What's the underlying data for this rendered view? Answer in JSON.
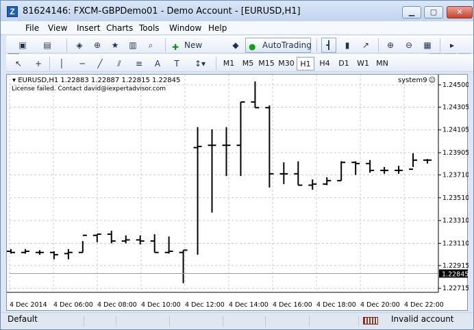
{
  "window": {
    "title": "81624146: FXCM-GBPDemo01 - Demo Account - [EURUSD,H1]",
    "app_icon_glyph": "Z"
  },
  "menu": [
    "File",
    "View",
    "Insert",
    "Charts",
    "Tools",
    "Window",
    "Help"
  ],
  "toolbar": {
    "new_order": "New Order",
    "autotrading": "AutoTrading",
    "timeframes": [
      "M1",
      "M5",
      "M15",
      "M30",
      "H1",
      "H4",
      "D1",
      "W1",
      "MN"
    ],
    "active_timeframe": "H1",
    "icons": [
      "new-chart-icon",
      "profiles-icon",
      "market-watch-icon",
      "crosshair-icon",
      "star-icon",
      "navigator-icon",
      "strategy-tester-icon",
      "new-order-icon",
      "expert-hat-icon",
      "autotrading-icon",
      "bar-chart-icon",
      "candlestick-icon",
      "line-chart-icon",
      "zoom-in-icon",
      "zoom-out-icon",
      "tile-windows-icon",
      "auto-scroll-icon"
    ],
    "drawing_tools": [
      "cursor-icon",
      "crosshair-tool-icon",
      "vertical-line-icon",
      "horizontal-line-icon",
      "trendline-icon",
      "equidistant-channel-icon",
      "fibonacci-icon",
      "text-tool-icon",
      "text-label-icon",
      "arrow-tool-icon"
    ]
  },
  "chart": {
    "symbol_line": "EURUSD,H1  1.22883 1.22887 1.22815 1.22845",
    "message": "License failed.  Contact david@iexpertadvisor.com",
    "ea_name": "system9",
    "current_price": "1.22845",
    "colors": {
      "background": "#ffffff",
      "bars": "#000000",
      "grid": "#c8c8c8",
      "price_tag_bg": "#000000",
      "price_tag_text": "#ffffff"
    }
  },
  "chart_data": {
    "type": "ohlc",
    "title": "",
    "xlabel": "",
    "ylabel": "",
    "y_ticks": [
      1.2745,
      1.2943,
      1.2941,
      1.2939,
      1.2937,
      1.2935,
      1.2933,
      1.2931,
      1.2929,
      1.2927
    ],
    "y_tick_labels": [
      "1.24500",
      "1.24305",
      "1.24105",
      "1.23905",
      "1.23710",
      "1.23510",
      "1.23310",
      "1.23110",
      "1.22915",
      "1.22715"
    ],
    "x_tick_labels": [
      "4 Dec 2014",
      "4 Dec 06:00",
      "4 Dec 08:00",
      "4 Dec 10:00",
      "4 Dec 12:00",
      "4 Dec 14:00",
      "4 Dec 16:00",
      "4 Dec 18:00",
      "4 Dec 20:00",
      "4 Dec 22:00"
    ],
    "ylim": [
      1.2268,
      1.2459
    ],
    "bars": [
      {
        "open": 1.2304,
        "high": 1.2306,
        "low": 1.2302,
        "close": 1.2303
      },
      {
        "open": 1.2303,
        "high": 1.2306,
        "low": 1.2302,
        "close": 1.2304
      },
      {
        "open": 1.2303,
        "high": 1.2305,
        "low": 1.2301,
        "close": 1.2303
      },
      {
        "open": 1.2303,
        "high": 1.2304,
        "low": 1.2297,
        "close": 1.2301
      },
      {
        "open": 1.2302,
        "high": 1.2306,
        "low": 1.2297,
        "close": 1.2303
      },
      {
        "open": 1.2303,
        "high": 1.2313,
        "low": 1.2303,
        "close": 1.2318
      },
      {
        "open": 1.2318,
        "high": 1.2319,
        "low": 1.2312,
        "close": 1.2319
      },
      {
        "open": 1.2319,
        "high": 1.2322,
        "low": 1.2311,
        "close": 1.2313
      },
      {
        "open": 1.2313,
        "high": 1.2318,
        "low": 1.2311,
        "close": 1.2314
      },
      {
        "open": 1.2314,
        "high": 1.2318,
        "low": 1.231,
        "close": 1.2313
      },
      {
        "open": 1.2313,
        "high": 1.2319,
        "low": 1.2303,
        "close": 1.2303
      },
      {
        "open": 1.2303,
        "high": 1.2317,
        "low": 1.2302,
        "close": 1.2304
      },
      {
        "open": 1.2303,
        "high": 1.2305,
        "low": 1.2276,
        "close": 1.2305
      },
      {
        "open": 1.2395,
        "high": 1.2413,
        "low": 1.2301,
        "close": 1.2396
      },
      {
        "open": 1.2397,
        "high": 1.2411,
        "low": 1.2338,
        "close": 1.2397
      },
      {
        "open": 1.2397,
        "high": 1.2413,
        "low": 1.237,
        "close": 1.2397
      },
      {
        "open": 1.2397,
        "high": 1.2435,
        "low": 1.237,
        "close": 1.2435
      },
      {
        "open": 1.2435,
        "high": 1.2453,
        "low": 1.243,
        "close": 1.243
      },
      {
        "open": 1.243,
        "high": 1.2432,
        "low": 1.236,
        "close": 1.2372
      },
      {
        "open": 1.2372,
        "high": 1.2382,
        "low": 1.2363,
        "close": 1.2372
      },
      {
        "open": 1.2372,
        "high": 1.2383,
        "low": 1.2362,
        "close": 1.2362
      },
      {
        "open": 1.2362,
        "high": 1.2367,
        "low": 1.2358,
        "close": 1.2363
      },
      {
        "open": 1.2363,
        "high": 1.2369,
        "low": 1.2362,
        "close": 1.2366
      },
      {
        "open": 1.2366,
        "high": 1.2383,
        "low": 1.2366,
        "close": 1.2382
      },
      {
        "open": 1.2382,
        "high": 1.2383,
        "low": 1.2371,
        "close": 1.2381
      },
      {
        "open": 1.2381,
        "high": 1.2384,
        "low": 1.2373,
        "close": 1.2375
      },
      {
        "open": 1.2375,
        "high": 1.2378,
        "low": 1.2372,
        "close": 1.2375
      },
      {
        "open": 1.2375,
        "high": 1.2379,
        "low": 1.2372,
        "close": 1.2375
      },
      {
        "open": 1.2376,
        "high": 1.239,
        "low": 1.2378,
        "close": 1.2384
      },
      {
        "open": 1.2384,
        "high": 1.2385,
        "low": 1.2381,
        "close": 1.2384
      }
    ]
  },
  "status": {
    "profile": "Default",
    "account": "Invalid account"
  }
}
